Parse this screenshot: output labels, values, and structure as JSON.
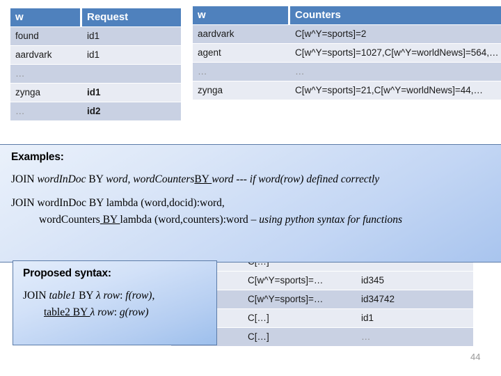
{
  "colors": {
    "table_header_blue": "#4F81BD",
    "row_dark": "#C9D1E3",
    "row_light": "#E8EBF3",
    "callout_border": "#5B7BA8",
    "slide_number_gray": "#9A9A9A"
  },
  "tables": {
    "request": {
      "headers": [
        "w",
        "Request"
      ],
      "rows": [
        {
          "w": "found",
          "request": "id1",
          "bold": false,
          "dim": false
        },
        {
          "w": "aardvark",
          "request": "id1",
          "bold": false,
          "dim": false
        },
        {
          "w": "…",
          "request": "",
          "bold": false,
          "dim": false
        },
        {
          "w": "zynga",
          "request": "id1",
          "bold": true,
          "dim": false
        },
        {
          "w": "…",
          "request": "id2",
          "bold": true,
          "dim": true
        }
      ]
    },
    "counters": {
      "headers": [
        "w",
        "Counters"
      ],
      "rows": [
        {
          "w": "aardvark",
          "counters": "C[w^Y=sports]=2"
        },
        {
          "w": "agent",
          "counters": "C[w^Y=sports]=1027,C[w^Y=worldNews]=564,…"
        },
        {
          "w": "…",
          "counters": "…"
        },
        {
          "w": "zynga",
          "counters": "C[w^Y=sports]=21,C[w^Y=worldNews]=44,…"
        }
      ]
    },
    "bottom": {
      "rows": [
        {
          "c1": "",
          "c2": "C[…]",
          "c3": ""
        },
        {
          "c1": "",
          "c2": "C[w^Y=sports]=…",
          "c3": "id345"
        },
        {
          "c1": "",
          "c2": "C[w^Y=sports]=…",
          "c3": "id34742"
        },
        {
          "c1": "",
          "c2": "C[…]",
          "c3": "id1"
        },
        {
          "c1": "",
          "c2": "C[…]",
          "c3": "…"
        }
      ]
    }
  },
  "examples_box": {
    "title": "Examples:",
    "line1": {
      "p1": "JOIN ",
      "i1": "wordInDoc",
      "p2": " BY ",
      "i2": "word, wordCounters",
      "u1": "BY ",
      "i3": " word ",
      "p3": " --- ",
      "i4": "if word(row) defined correctly"
    },
    "line2": {
      "p1": "JOIN wordInDoc BY lambda (word,docid):word,"
    },
    "line3": {
      "p1": "wordCounters",
      "u1": " BY ",
      "p2": "lambda (word,counters):word – ",
      "i1": "using python syntax for functions"
    }
  },
  "proposed_box": {
    "title": "Proposed syntax:",
    "line1": {
      "p1": "JOIN ",
      "i1": "table1",
      "p2": " BY ",
      "i2": "λ row",
      "p3": ": ",
      "i3": "f(row)",
      "p4": ","
    },
    "line2": {
      "u1": "table2 BY ",
      "i1": " λ row",
      "p1": ": ",
      "i2": "g(row)"
    }
  },
  "slide_number": "44"
}
